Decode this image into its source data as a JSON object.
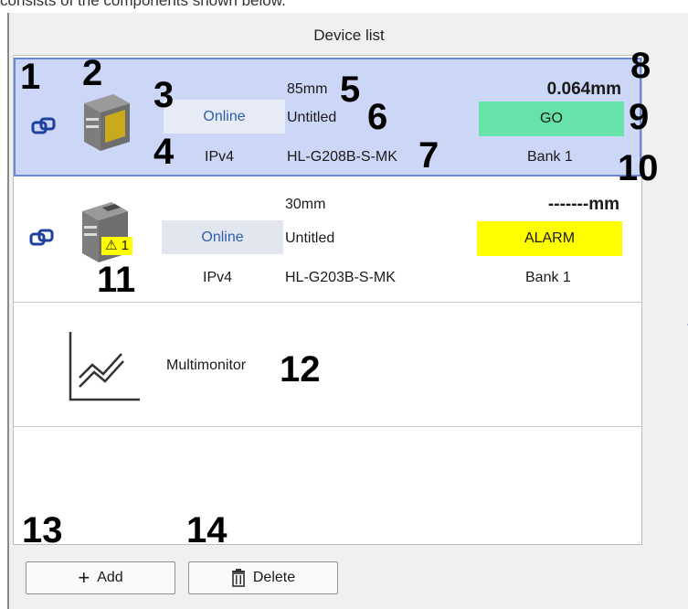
{
  "intro_text": "consists of the components shown below.",
  "panel": {
    "title": "Device list"
  },
  "devices": [
    {
      "status": "Online",
      "protocol": "IPv4",
      "range": "85mm",
      "name": "Untitled",
      "model": "HL-G208B-S-MK",
      "measurement": "0.064mm",
      "judgment": "GO",
      "judgment_color": "#66e4a8",
      "bank": "Bank 1",
      "selected": true
    },
    {
      "status": "Online",
      "protocol": "IPv4",
      "range": "30mm",
      "name": "Untitled",
      "model": "HL-G203B-S-MK",
      "measurement": "-------mm",
      "judgment": "ALARM",
      "judgment_color": "#ffff00",
      "bank": "Bank 1",
      "warning": "⚠ 1",
      "selected": false
    }
  ],
  "multimonitor": {
    "label": "Multimonitor"
  },
  "buttons": {
    "add": "Add",
    "delete": "Delete"
  },
  "callouts": [
    "1",
    "2",
    "3",
    "4",
    "5",
    "6",
    "7",
    "8",
    "9",
    "10",
    "11",
    "12",
    "13",
    "14"
  ],
  "colors": {
    "accent": "#6a88dc",
    "link_icon": "#1f3f9e",
    "selected_bg": "#ccd6f6"
  }
}
